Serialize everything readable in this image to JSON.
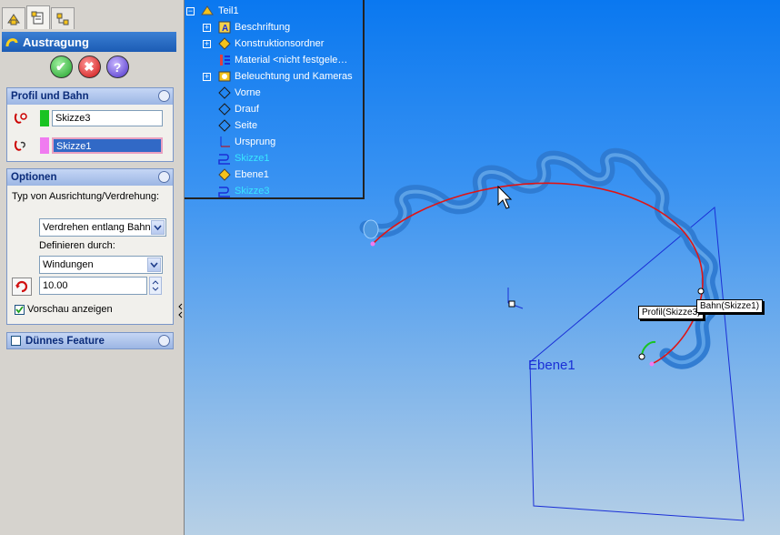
{
  "tabs": [
    {
      "icon": "feature-manager-icon"
    },
    {
      "icon": "property-manager-icon"
    },
    {
      "icon": "configuration-manager-icon"
    }
  ],
  "panel_title": "Austragung",
  "actions": {
    "ok": "✔",
    "cancel": "✖",
    "help": "?"
  },
  "profile_section": {
    "title": "Profil und Bahn",
    "profile_value": "Skizze3",
    "path_value": "Skizze1",
    "profile_color": "#19c322",
    "path_color": "#f07bf0"
  },
  "options_section": {
    "title": "Optionen",
    "orientation_label": "Typ von Ausrichtung/Verdrehung:",
    "orientation_value": "Verdrehen entlang Bahn",
    "define_label": "Definieren durch:",
    "define_value": "Windungen",
    "turns_value": "10.00",
    "preview_label": "Vorschau anzeigen",
    "preview_checked": true
  },
  "thin_feature": {
    "label": "Dünnes Feature",
    "checked": false
  },
  "tree": {
    "root": "Teil1",
    "items": [
      {
        "label": "Beschriftung",
        "icon": "annotation-icon",
        "expandable": true
      },
      {
        "label": "Konstruktionsordner",
        "icon": "design-binder-icon",
        "expandable": true
      },
      {
        "label": "Material <nicht festgele…",
        "icon": "material-icon",
        "expandable": false
      },
      {
        "label": "Beleuchtung und Kameras",
        "icon": "lights-icon",
        "expandable": true
      },
      {
        "label": "Vorne",
        "icon": "plane-icon",
        "expandable": false
      },
      {
        "label": "Drauf",
        "icon": "plane-icon",
        "expandable": false
      },
      {
        "label": "Seite",
        "icon": "plane-icon",
        "expandable": false
      },
      {
        "label": "Ursprung",
        "icon": "origin-icon",
        "expandable": false
      },
      {
        "label": "Skizze1",
        "icon": "sketch-icon",
        "expandable": false,
        "highlight": true
      },
      {
        "label": "Ebene1",
        "icon": "plane-icon",
        "expandable": false
      },
      {
        "label": "Skizze3",
        "icon": "sketch-icon",
        "expandable": false,
        "highlight": true
      }
    ]
  },
  "viewport": {
    "plane_label": "Ebene1",
    "callout_profile": "Profil(Skizze3)",
    "callout_path": "Bahn(Skizze1)"
  }
}
